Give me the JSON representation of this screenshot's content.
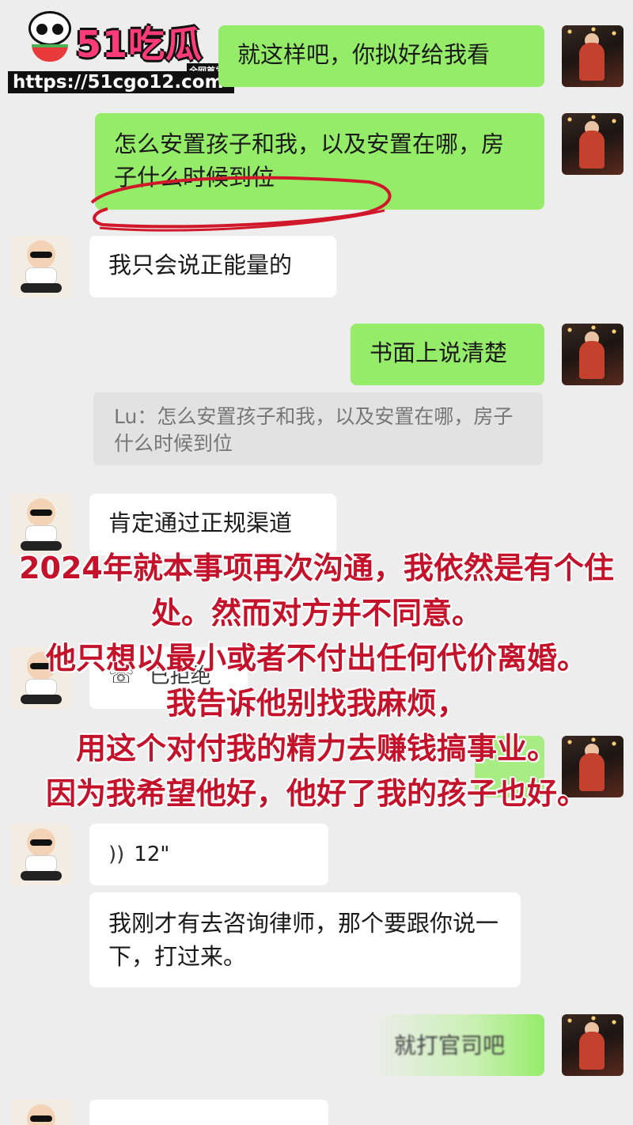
{
  "watermark": {
    "brand": "51吃瓜",
    "tag": "全网首发",
    "url": "https://51cgo12.com"
  },
  "messages": [
    {
      "side": "right",
      "text": "就这样吧，你拟好给我看"
    },
    {
      "side": "right",
      "text": "怎么安置孩子和我，以及安置在哪，房子什么时候到位"
    },
    {
      "side": "left",
      "text": "我只会说正能量的"
    },
    {
      "side": "right",
      "text": "书面上说清楚"
    },
    {
      "side": "right",
      "quote": "Lu：怎么安置孩子和我，以及安置在哪，房子什么时候到位"
    },
    {
      "side": "left",
      "text": "肯定通过正规渠道"
    },
    {
      "side": "left",
      "call_status": "已拒绝"
    },
    {
      "side": "left",
      "voice_duration": "12\""
    },
    {
      "side": "left",
      "text": "我刚才有去咨询律师，那个要跟你说一下，打过来。"
    },
    {
      "side": "right",
      "text": "就打官司吧"
    }
  ],
  "overlay_lines": [
    "2024年就本事项再次沟通，我依然是有个住",
    "处。然而对方并不同意。",
    "他只想以最小或者不付出任何代价离婚。",
    "我告诉他别找我麻烦，",
    "用这个对付我的精力去赚钱搞事业。",
    "因为我希望他好，他好了我的孩子也好。"
  ],
  "colors": {
    "background": "#ededed",
    "sent_bubble": "#95ec69",
    "received_bubble": "#ffffff",
    "overlay_text": "#c4122a",
    "annotation": "#d0182a"
  },
  "icons": [
    "phone-icon",
    "voice-wave-icon",
    "user-avatar-icon",
    "contact-avatar-icon"
  ]
}
